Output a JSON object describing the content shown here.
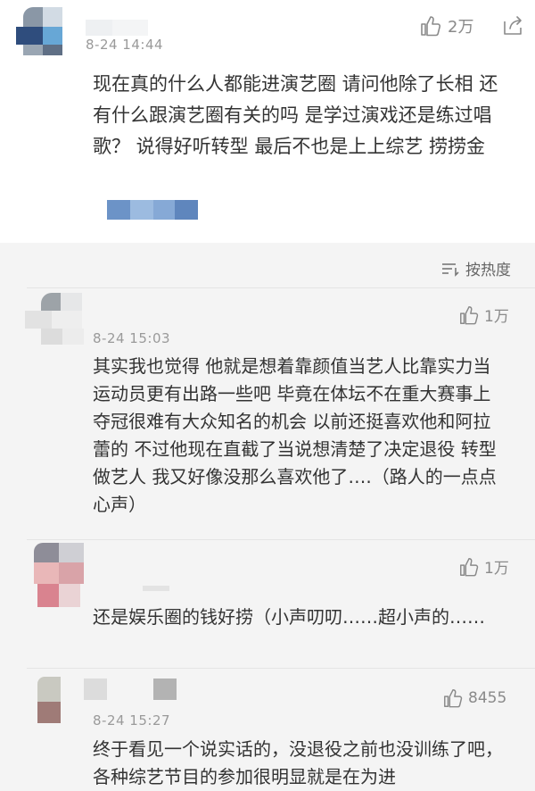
{
  "comments": [
    {
      "timestamp": "8-24 14:44",
      "likes": "2万",
      "text": "现在真的什么人都能进演艺圈 请问他除了长相 还有什么跟演艺圈有关的吗 是学过演戏还是练过唱歌？ 说得好听转型 最后不也是上上综艺 捞捞金"
    },
    {
      "timestamp": "8-24 15:03",
      "likes": "1万",
      "text": "其实我也觉得 他就是想着靠颜值当艺人比靠实力当运动员更有出路一些吧 毕竟在体坛不在重大赛事上夺冠很难有大众知名的机会 以前还挺喜欢他和阿拉蕾的 不过他现在直截了当说想清楚了决定退役 转型做艺人 我又好像没那么喜欢他了….（路人的一点点心声）"
    },
    {
      "likes": "1万",
      "text": "还是娱乐圈的钱好捞（小声叨叨……超小声的……"
    },
    {
      "timestamp": "8-24 15:27",
      "likes": "8455",
      "text": "终于看见一个说实话的，没退役之前也没训练了吧，各种综艺节目的参加很明显就是在为进"
    }
  ],
  "sort": {
    "label": "按热度"
  },
  "icons": {
    "like": "thumbs-up-icon",
    "share": "share-icon",
    "sort": "sort-icon"
  },
  "colors": {
    "page_bg": "#f4f4f4",
    "card_bg": "#ffffff",
    "text": "#333333",
    "meta": "#9a9a9a"
  }
}
